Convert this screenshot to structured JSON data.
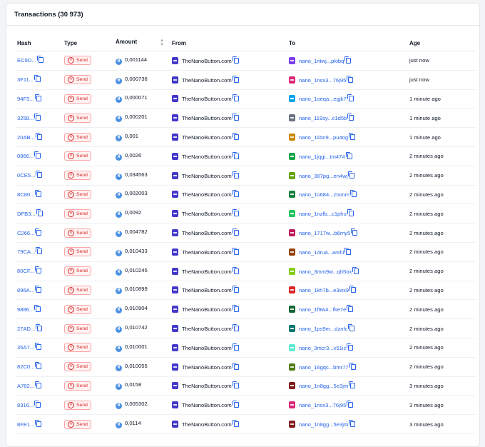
{
  "header": {
    "title": "Transactions (30 973)"
  },
  "columns": {
    "hash": "Hash",
    "type": "Type",
    "amount": "Amount",
    "from": "From",
    "to": "To",
    "age": "Age"
  },
  "rows": [
    {
      "hash": "EC9D...",
      "type": "Send",
      "amount": "0,001144",
      "from": "TheNanoButton.com",
      "to": "nano_1ntwj...pkibq",
      "age": "just now",
      "from_color": "#4338ca",
      "to_color": "#7c3aed"
    },
    {
      "hash": "3F11...",
      "type": "Send",
      "amount": "0,000736",
      "from": "TheNanoButton.com",
      "to": "nano_1nsx3...76j95",
      "age": "just now",
      "from_color": "#4338ca",
      "to_color": "#db2777"
    },
    {
      "hash": "94F3...",
      "type": "Send",
      "amount": "0,000071",
      "from": "TheNanoButton.com",
      "to": "nano_1oeqa...egjk7",
      "age": "1 minute ago",
      "from_color": "#4338ca",
      "to_color": "#0ea5e9"
    },
    {
      "hash": "3258...",
      "type": "Send",
      "amount": "0,000201",
      "from": "TheNanoButton.com",
      "to": "nano_119sy...c1d5b",
      "age": "1 minute ago",
      "from_color": "#4338ca",
      "to_color": "#6b7280"
    },
    {
      "hash": "20AB...",
      "type": "Send",
      "amount": "0,001",
      "from": "TheNanoButton.com",
      "to": "nano_11bn9...pu4og",
      "age": "1 minute ago",
      "from_color": "#4338ca",
      "to_color": "#ca8a04"
    },
    {
      "hash": "0866...",
      "type": "Send",
      "amount": "0,0026",
      "from": "TheNanoButton.com",
      "to": "nano_1jqgi...tm474",
      "age": "2 minutes ago",
      "from_color": "#4338ca",
      "to_color": "#16a34a"
    },
    {
      "hash": "0CE5...",
      "type": "Send",
      "amount": "0,034563",
      "from": "TheNanoButton.com",
      "to": "nano_387pg...en4wj",
      "age": "2 minutes ago",
      "from_color": "#4338ca",
      "to_color": "#65a30d"
    },
    {
      "hash": "8C80...",
      "type": "Send",
      "amount": "0,002003",
      "from": "TheNanoButton.com",
      "to": "nano_1o684...ztxmm",
      "age": "2 minutes ago",
      "from_color": "#4338ca",
      "to_color": "#15803d"
    },
    {
      "hash": "DFB3...",
      "type": "Send",
      "amount": "0,0092",
      "from": "TheNanoButton.com",
      "to": "nano_1nzfb...c1phu",
      "age": "2 minutes ago",
      "from_color": "#4338ca",
      "to_color": "#22c55e"
    },
    {
      "hash": "C266...",
      "type": "Send",
      "amount": "0,004782",
      "from": "TheNanoButton.com",
      "to": "nano_1717w...b6my5",
      "age": "2 minutes ago",
      "from_color": "#4338ca",
      "to_color": "#be185d"
    },
    {
      "hash": "79CA...",
      "type": "Send",
      "amount": "0,010433",
      "from": "TheNanoButton.com",
      "to": "nano_14rua...arshi",
      "age": "2 minutes ago",
      "from_color": "#4338ca",
      "to_color": "#92400e"
    },
    {
      "hash": "80CF...",
      "type": "Send",
      "amount": "0,010245",
      "from": "TheNanoButton.com",
      "to": "nano_3mm9w...qh5ox",
      "age": "2 minutes ago",
      "from_color": "#4338ca",
      "to_color": "#84cc16"
    },
    {
      "hash": "896A...",
      "type": "Send",
      "amount": "0,010899",
      "from": "TheNanoButton.com",
      "to": "nano_1kh7b...e3wx9",
      "age": "2 minutes ago",
      "from_color": "#4338ca",
      "to_color": "#dc2626"
    },
    {
      "hash": "9886...",
      "type": "Send",
      "amount": "0,010904",
      "from": "TheNanoButton.com",
      "to": "nano_1f9w4...fke7e",
      "age": "2 minutes ago",
      "from_color": "#4338ca",
      "to_color": "#166534"
    },
    {
      "hash": "27AD...",
      "type": "Send",
      "amount": "0,010742",
      "from": "TheNanoButton.com",
      "to": "nano_1ps9m...dznfc",
      "age": "2 minutes ago",
      "from_color": "#4338ca",
      "to_color": "#0f766e"
    },
    {
      "hash": "35A7...",
      "type": "Send",
      "amount": "0,010001",
      "from": "TheNanoButton.com",
      "to": "nano_3mcr3...x51ic",
      "age": "2 minutes ago",
      "from_color": "#4338ca",
      "to_color": "#5eead4"
    },
    {
      "hash": "82C0...",
      "type": "Send",
      "amount": "0,010055",
      "from": "TheNanoButton.com",
      "to": "nano_16gqc...bmr77",
      "age": "2 minutes ago",
      "from_color": "#4338ca",
      "to_color": "#4d7c0f"
    },
    {
      "hash": "A782...",
      "type": "Send",
      "amount": "0,0158",
      "from": "TheNanoButton.com",
      "to": "nano_1n8gg...5e3jm",
      "age": "3 minutes ago",
      "from_color": "#4338ca",
      "to_color": "#7f1d1d"
    },
    {
      "hash": "8316...",
      "type": "Send",
      "amount": "0,005302",
      "from": "TheNanoButton.com",
      "to": "nano_1nsx3...76j95",
      "age": "3 minutes ago",
      "from_color": "#4338ca",
      "to_color": "#db2777"
    },
    {
      "hash": "8FE1...",
      "type": "Send",
      "amount": "0,0114",
      "from": "TheNanoButton.com",
      "to": "nano_1n8gg...5e3jm",
      "age": "3 minutes ago",
      "from_color": "#4338ca",
      "to_color": "#7f1d1d"
    }
  ],
  "colors": {
    "link": "#2563eb",
    "badge_red": "#dc2626",
    "nano_blue": "#4a90e2"
  }
}
